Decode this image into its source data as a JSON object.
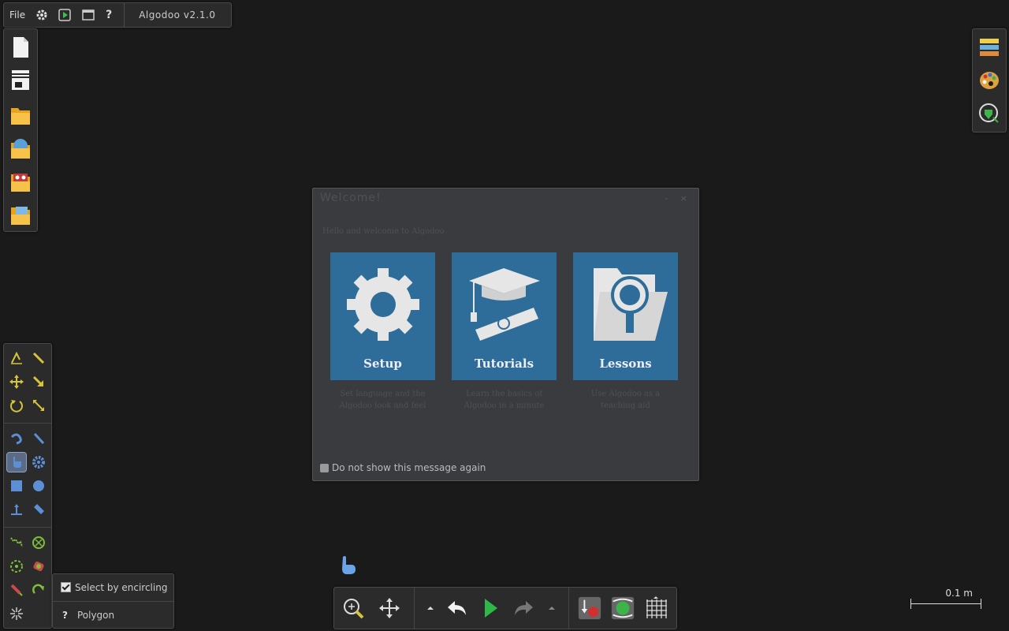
{
  "menubar": {
    "file_label": "File",
    "version": "Algodoo v2.1.0",
    "icons": [
      "gear-icon",
      "run-icon",
      "window-icon",
      "help-icon"
    ],
    "help_label": "?"
  },
  "filebar": {
    "buttons": [
      "new-scene-icon",
      "scene-layout-icon",
      "open-folder-icon",
      "open-web-icon",
      "open-favorite-icon",
      "open-phunlet-icon"
    ]
  },
  "rightbar": {
    "buttons": [
      "layers-icon",
      "palette-icon",
      "download-icon"
    ]
  },
  "dialog": {
    "title": "Welcome!",
    "window_controls": "- ×",
    "greeting": "Hello and welcome to Algodoo",
    "cards": [
      {
        "label": "Setup",
        "description": "Set language and the Algodoo look and feel"
      },
      {
        "label": "Tutorials",
        "description": "Learn the basics of Algodoo in a minute"
      },
      {
        "label": "Lessons",
        "description": "Use Algodoo as a teaching aid"
      }
    ],
    "dont_show_label": "Do not show this message again"
  },
  "tool_options": {
    "select_by_encircling": "Select by encircling",
    "polygon": "Polygon",
    "help_mark": "?"
  },
  "scale": {
    "label": "0.1 m"
  },
  "colors": {
    "background": "#1a1a1a",
    "panel": "#2b2b2b",
    "dialog": "#3a3b3e",
    "card": "#2e6d9a",
    "tool_yellow": "#d8c43a",
    "tool_blue": "#5b8fd6",
    "tool_green": "#7fbf3a",
    "play_green": "#2db84a"
  }
}
